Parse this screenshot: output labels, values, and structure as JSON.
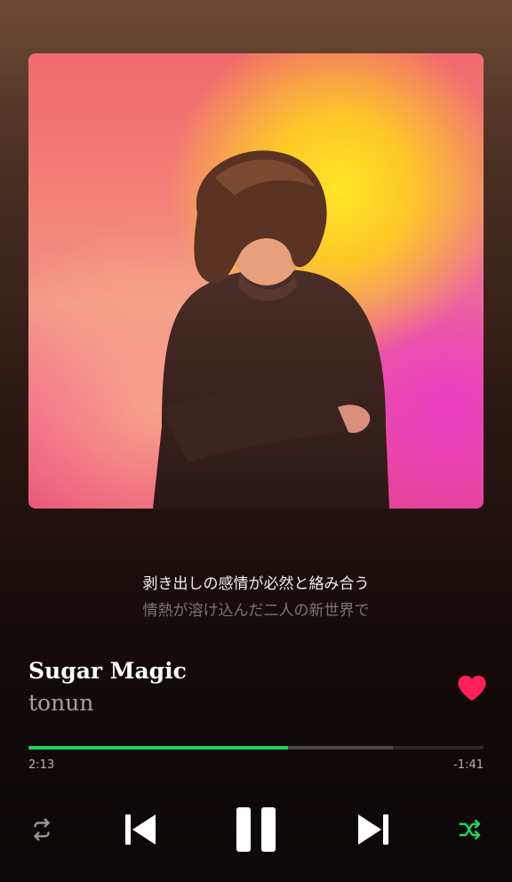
{
  "lyrics": {
    "current": "剥き出しの感情が必然と絡み合う",
    "next": "情熱が溶け込んだ二人の新世界で"
  },
  "track": {
    "title": "Sugar Magic",
    "artist": "tonun",
    "liked": true
  },
  "playback": {
    "elapsed": "2:13",
    "remaining": "-1:41",
    "progress": 0.57,
    "buffered": 0.8,
    "state": "playing",
    "shuffle": true,
    "repeat": false
  },
  "controls": {
    "repeat_icon": "repeat-icon",
    "previous_icon": "skip-previous-icon",
    "pause_icon": "pause-icon",
    "next_icon": "skip-next-icon",
    "shuffle_icon": "shuffle-icon"
  },
  "colors": {
    "accent": "#1ed25e",
    "like": "#ff1f5a"
  }
}
